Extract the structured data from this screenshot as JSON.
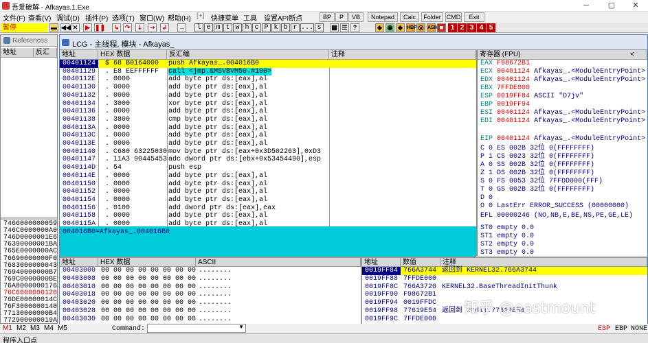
{
  "window": {
    "title": "吾爱破解 - Afkayas.1.Exe",
    "min": "─",
    "max": "▢",
    "close": "✕"
  },
  "menu": [
    "文件(F)",
    "查看(V)",
    "调试(D)",
    "插件(P)",
    "选项(T)",
    "窗口(W)",
    "帮助(H)",
    "[+]",
    "快捷菜单",
    "工具",
    "设置API断点"
  ],
  "toolbuttons": [
    "BP",
    "P",
    "VB",
    "Notepad",
    "Calc",
    "Folder",
    "CMD",
    "Exit"
  ],
  "status_state": "暂停",
  "letter_buttons": [
    "l",
    "e",
    "m",
    "t",
    "w",
    "h",
    "c",
    "P",
    "k",
    "b",
    "r",
    "...",
    "s"
  ],
  "num_buttons": [
    "1",
    "2",
    "3",
    "4",
    "5"
  ],
  "left": {
    "ref_title": "References",
    "col1": "地址",
    "col2": "反汇",
    "rows": [
      [
        "74660000",
        "00059"
      ],
      [
        "746C0000",
        "000A0"
      ],
      [
        "746D0000",
        "001E6"
      ],
      [
        "76390000",
        "001BA"
      ],
      [
        "765E0000",
        "000AC"
      ],
      [
        "76690000",
        "000F0"
      ],
      [
        "76830000",
        "00043"
      ],
      [
        "76940000",
        "000B7"
      ],
      [
        "769C0000",
        "000BE"
      ],
      [
        "76A80000",
        "00176"
      ],
      [
        "76C60000",
        "00120"
      ],
      [
        "76DE0000",
        "0014C"
      ],
      [
        "76F30000",
        "00140"
      ],
      [
        "77130000",
        "000B4"
      ],
      [
        "77290000",
        "0019A"
      ]
    ]
  },
  "cpu": {
    "title": "LCG - 主线程, 模块 - Afkayas_",
    "h_addr": "地址",
    "h_hex": "HEX 数据",
    "h_asm": "反汇编",
    "h_comment": "注释",
    "rows": [
      {
        "a": "00401124",
        "m": "$",
        "h": "68 B0164000",
        "s": "push Afkayas_.004016B0"
      },
      {
        "a": "00401129",
        "m": ".",
        "h": "E8 EEFFFFFF",
        "s": "call <jmp.&MSVBVM50.#100>"
      },
      {
        "a": "0040112E",
        "m": ".",
        "h": "0000",
        "s": "add byte ptr ds:[eax],al"
      },
      {
        "a": "00401130",
        "m": ".",
        "h": "0000",
        "s": "add byte ptr ds:[eax],al"
      },
      {
        "a": "00401132",
        "m": ".",
        "h": "0000",
        "s": "add byte ptr ds:[eax],al"
      },
      {
        "a": "00401134",
        "m": ".",
        "h": "3000",
        "s": "xor byte ptr ds:[eax],al"
      },
      {
        "a": "00401136",
        "m": ".",
        "h": "0000",
        "s": "add byte ptr ds:[eax],al"
      },
      {
        "a": "00401138",
        "m": ".",
        "h": "3800",
        "s": "cmp byte ptr ds:[eax],al"
      },
      {
        "a": "0040113A",
        "m": ".",
        "h": "0000",
        "s": "add byte ptr ds:[eax],al"
      },
      {
        "a": "0040113C",
        "m": ".",
        "h": "0000",
        "s": "add byte ptr ds:[eax],al"
      },
      {
        "a": "0040113E",
        "m": ".",
        "h": "0000",
        "s": "add byte ptr ds:[eax],al"
      },
      {
        "a": "00401140",
        "m": ".",
        "h": "C680 63225030",
        "s": "mov byte ptr ds:[eax+0x3D502263],0xD3"
      },
      {
        "a": "00401147",
        "m": ".",
        "h": "11A3 90445453",
        "s": "adc dword ptr ds:[ebx+0x53454490],esp"
      },
      {
        "a": "0040114D",
        "m": ".",
        "h": "54",
        "s": "push esp"
      },
      {
        "a": "0040114E",
        "m": ".",
        "h": "0000",
        "s": "add byte ptr ds:[eax],al"
      },
      {
        "a": "00401150",
        "m": ".",
        "h": "0000",
        "s": "add byte ptr ds:[eax],al"
      },
      {
        "a": "00401152",
        "m": ".",
        "h": "0000",
        "s": "add byte ptr ds:[eax],al"
      },
      {
        "a": "00401154",
        "m": ".",
        "h": "0000",
        "s": "add byte ptr ds:[eax],al"
      },
      {
        "a": "00401156",
        "m": ".",
        "h": "0100",
        "s": "add dword ptr ds:[eax],eax"
      },
      {
        "a": "00401158",
        "m": ".",
        "h": "0000",
        "s": "add byte ptr ds:[eax],al"
      },
      {
        "a": "0040115A",
        "m": ".",
        "h": "0000",
        "s": "add byte ptr ds:[eax],al"
      }
    ]
  },
  "info": "004016B0=Afkayas_.004016B0",
  "regs": {
    "title": "寄存器 (FPU)",
    "lines": [
      [
        "EAX",
        "F98672B1",
        ""
      ],
      [
        "ECX",
        "00401124",
        "Afkayas_.<ModuleEntryPoint>"
      ],
      [
        "EDX",
        "00401124",
        "Afkayas_.<ModuleEntryPoint>"
      ],
      [
        "EBX",
        "7FFDE000",
        ""
      ],
      [
        "ESP",
        "0019FF84",
        "ASCII \"D7jv\""
      ],
      [
        "EBP",
        "0019FF94",
        ""
      ],
      [
        "ESI",
        "00401124",
        "Afkayas_.<ModuleEntryPoint>"
      ],
      [
        "EDI",
        "00401124",
        "Afkayas_.<ModuleEntryPoint>"
      ],
      [
        "",
        "",
        " "
      ],
      [
        "EIP",
        "00401124",
        "Afkayas_.<ModuleEntryPoint>"
      ]
    ],
    "flags": [
      "C 0  ES 002B 32位 0(FFFFFFFF)",
      "P 1  CS 0023 32位 0(FFFFFFFF)",
      "A 0  SS 002B 32位 0(FFFFFFFF)",
      "Z 1  DS 002B 32位 0(FFFFFFFF)",
      "S 0  FS 0053 32位 7FFDD000(FFF)",
      "T 0  GS 002B 32位 0(FFFFFFFF)",
      "D 0",
      "O 0  LastErr ERROR_SUCCESS (00000000)"
    ],
    "efl": "EFL 00000246 (NO,NB,E,BE,NS,PE,GE,LE)",
    "st": [
      "ST0 empty 0.0",
      "ST1 empty 0.0",
      "ST2 empty 0.0",
      "ST3 empty 0.0"
    ]
  },
  "dump": {
    "h_addr": "地址",
    "h_hex": "HEX 数据",
    "h_ascii": "ASCII",
    "rows": [
      [
        "00403000",
        "00 00 00 00 00 00 00 00",
        "........"
      ],
      [
        "00403008",
        "00 00 00 00 00 00 00 00",
        "........"
      ],
      [
        "00403010",
        "00 00 00 00 00 00 00 00",
        "........"
      ],
      [
        "00403018",
        "00 00 00 00 00 00 00 00",
        "........"
      ],
      [
        "00403020",
        "00 00 00 00 00 00 00 00",
        "........"
      ],
      [
        "00403028",
        "00 00 00 00 00 00 00 00",
        "........"
      ],
      [
        "00403030",
        "00 00 00 00 00 00 00 00",
        "........"
      ]
    ]
  },
  "stack": {
    "h_addr": "地址",
    "h_val": "数值",
    "h_cmt": "注释",
    "rows": [
      [
        "0019FF84",
        "766A3744",
        "返回到 KERNEL32.766A3744"
      ],
      [
        "0019FF88",
        "7FFDE000",
        ""
      ],
      [
        "0019FF8C",
        "766A3720",
        "KERNEL32.BaseThreadInitThunk"
      ],
      [
        "0019FF90",
        "F98672B1",
        ""
      ],
      [
        "0019FF94",
        "0019FFDC",
        ""
      ],
      [
        "0019FF98",
        "77619E54",
        "返回到 ntdll.77619E54"
      ],
      [
        "0019FF9C",
        "7FFDE000",
        ""
      ]
    ]
  },
  "cmd": {
    "tabs": [
      "M1",
      "M2",
      "M3",
      "M4",
      "M5"
    ],
    "label": "Command:",
    "esp": "ESP",
    "ebp": "EBP",
    "none": "NONE"
  },
  "statusbar": "程序入口点",
  "watermark": "知乎 @eastmount"
}
